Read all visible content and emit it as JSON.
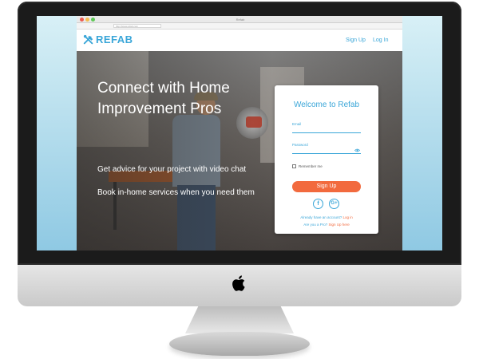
{
  "browser": {
    "window_title": "Refab",
    "url": "http://www.refab.com",
    "traffic_light_colors": [
      "#ee5b4f",
      "#f4bd4f",
      "#5fc957"
    ]
  },
  "header": {
    "logo_icon": "tools-icon",
    "brand": "REFAB",
    "nav": {
      "signup": "Sign Up",
      "login": "Log In"
    }
  },
  "hero": {
    "title_line1": "Connect with Home",
    "title_line2": "Improvement Pros",
    "line1": "Get advice for your project with video chat",
    "line2": "Book in-home services when you need them"
  },
  "card": {
    "title": "Welcome to Refab",
    "email_label": "Email",
    "email_value": "",
    "password_label": "Password",
    "password_value": "",
    "remember_label": "Remember me",
    "remember_checked": false,
    "signup_button": "Sign Up",
    "social": {
      "facebook": "f",
      "google": "G+"
    },
    "have_account_text": "Already have an account?",
    "login_link": "Log in",
    "pro_text": "Are you a Pro?",
    "pro_link": "Sign Up here"
  },
  "colors": {
    "brand_blue": "#3aa6d8",
    "cta_orange": "#f26a3e"
  },
  "device": {
    "logo_icon": "apple-logo-icon"
  }
}
